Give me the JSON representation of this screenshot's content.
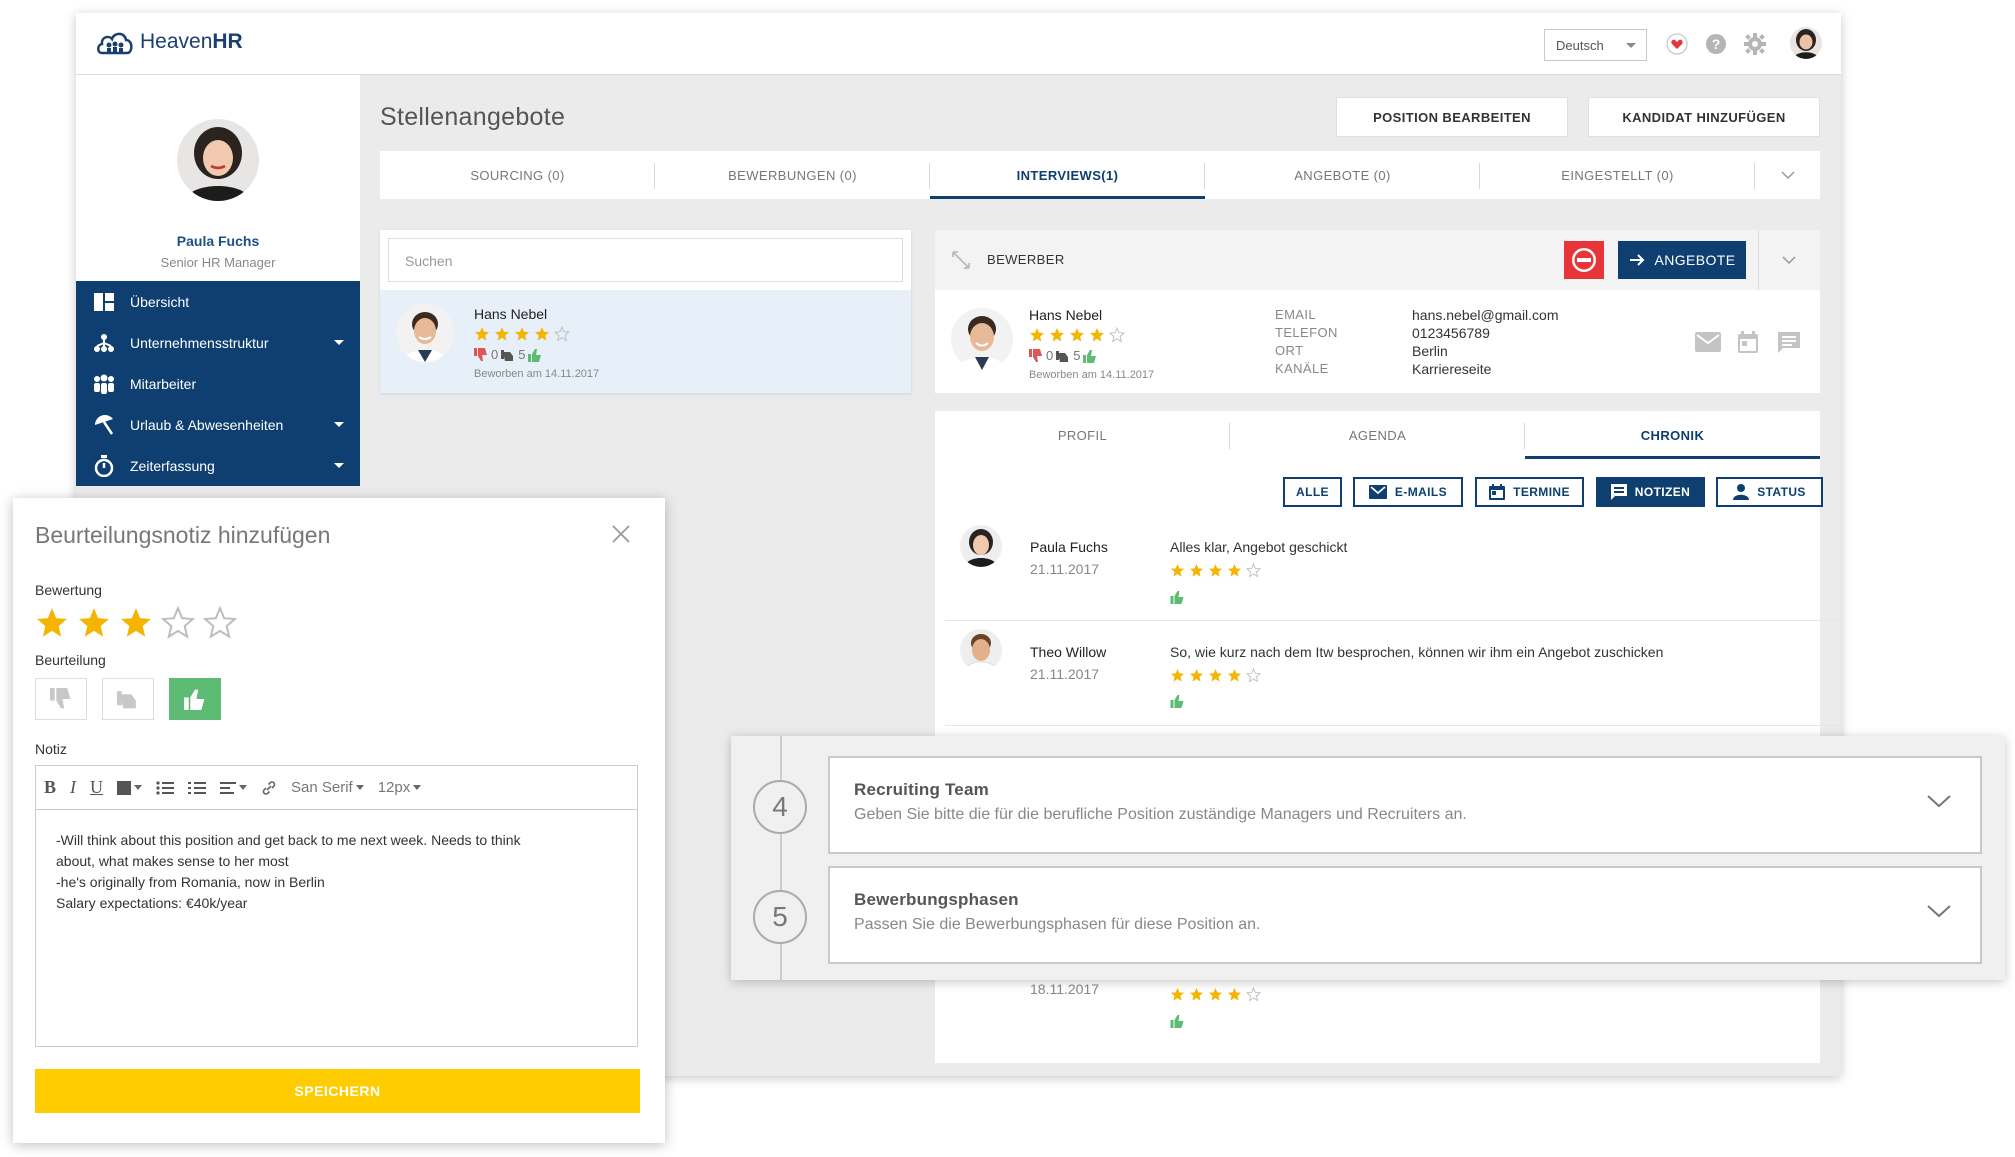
{
  "app": {
    "logo_text_1": "Heaven",
    "logo_text_2": "HR",
    "language": "Deutsch"
  },
  "sidebar": {
    "user_name": "Paula Fuchs",
    "user_role": "Senior HR Manager",
    "items": [
      {
        "label": "Übersicht",
        "icon": "dashboard-icon",
        "has_caret": false
      },
      {
        "label": "Unternehmensstruktur",
        "icon": "org-structure-icon",
        "has_caret": true
      },
      {
        "label": "Mitarbeiter",
        "icon": "people-icon",
        "has_caret": false
      },
      {
        "label": "Urlaub & Abwesenheiten",
        "icon": "beach-umbrella-icon",
        "has_caret": true
      },
      {
        "label": "Zeiterfassung",
        "icon": "stopwatch-icon",
        "has_caret": true
      }
    ]
  },
  "main": {
    "title": "Stellenangebote",
    "edit_position_button": "POSITION BEARBEITEN",
    "add_candidate_button": "KANDIDAT HINZUFÜGEN",
    "tabs": [
      {
        "label": "SOURCING (0)",
        "active": false
      },
      {
        "label": "BEWERBUNGEN (0)",
        "active": false
      },
      {
        "label": "INTERVIEWS(1)",
        "active": true
      },
      {
        "label": "ANGEBOTE (0)",
        "active": false
      },
      {
        "label": "EINGESTELLT (0)",
        "active": false
      }
    ]
  },
  "list": {
    "search_placeholder": "Suchen",
    "candidate": {
      "name": "Hans Nebel",
      "rating": 4,
      "thumbs_down": "0",
      "neutral": "5",
      "applied": "Beworben am 14.11.2017"
    }
  },
  "detail": {
    "header_label": "BEWERBER",
    "offers_button": "ANGEBOTE",
    "candidate_name": "Hans Nebel",
    "rating": 4,
    "thumbs_down": "0",
    "neutral": "5",
    "applied": "Beworben am 14.11.2017",
    "fields": [
      {
        "label": "EMAIL",
        "value": "hans.nebel@gmail.com"
      },
      {
        "label": "TELEFON",
        "value": "0123456789"
      },
      {
        "label": "ORT",
        "value": "Berlin"
      },
      {
        "label": "KANÄLE",
        "value": "Karriereseite"
      }
    ],
    "sub_tabs": [
      {
        "label": "PROFIL",
        "active": false
      },
      {
        "label": "AGENDA",
        "active": false
      },
      {
        "label": "CHRONIK",
        "active": true
      }
    ],
    "filters": {
      "all": "ALLE",
      "emails": "E-MAILS",
      "appointments": "TERMINE",
      "notes": "NOTIZEN",
      "status": "STATUS"
    },
    "entries": [
      {
        "name": "Paula Fuchs",
        "date": "21.11.2017",
        "text": "Alles klar, Angebot geschickt",
        "rating": 4
      },
      {
        "name": "Theo Willow",
        "date": "21.11.2017",
        "text": "So, wie kurz nach dem Itw besprochen, können wir ihm ein Angebot zuschicken",
        "rating": 4
      }
    ],
    "partial_date": "18.11.2017",
    "partial_rating": 4
  },
  "modal": {
    "title": "Beurteilungsnotiz hinzufügen",
    "rating_label": "Bewertung",
    "rating": 3,
    "assessment_label": "Beurteilung",
    "assessment_selected": "positive",
    "note_label": "Notiz",
    "toolbar_font": "San Serif",
    "toolbar_size": "12px",
    "note_lines": [
      "-Will think about this position and get back to me next week. Needs to think",
      "about, what makes sense to her most",
      "-he's originally from Romania, now in Berlin",
      "Salary expectations: €40k/year"
    ],
    "save_button": "SPEICHERN"
  },
  "steps": [
    {
      "number": "4",
      "title": "Recruiting Team",
      "subtitle": "Geben Sie bitte die für die berufliche Position zuständige Managers und Recruiters an."
    },
    {
      "number": "5",
      "title": "Bewerbungsphasen",
      "subtitle": "Passen Sie die Bewerbungsphasen für diese Position an."
    }
  ],
  "colors": {
    "navy": "#0e3f70",
    "star": "#f5b400",
    "thumb_up": "#5dbb73",
    "thumb_down": "#e05555",
    "save": "#ffcc00",
    "reject": "#e8353a"
  }
}
